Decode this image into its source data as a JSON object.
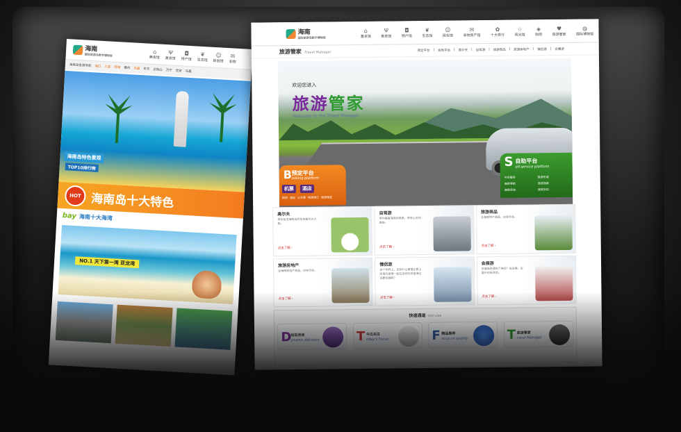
{
  "left_page": {
    "logo": {
      "name": "海南",
      "sub": "国际旅游岛数字博物馆"
    },
    "nav": [
      "美食馆",
      "美食馆",
      "特产馆",
      "生态馆",
      "民俗馆",
      "非物"
    ],
    "bar": [
      "海南岛各景导航",
      "海口",
      "三亚",
      "琼海",
      "儋州",
      "文昌",
      "东方",
      "五指山",
      "万宁",
      "定安",
      "屯昌"
    ],
    "banner": {
      "title": "海南岛特色景观",
      "sub": "TOP10排行榜"
    },
    "hot": {
      "badge": "HOT",
      "text": "海南岛十大特色"
    },
    "bay": {
      "en": "bay",
      "cn": "海南十大海湾"
    },
    "sea": {
      "label": "NO.1  天下第一湾  亚龙湾"
    }
  },
  "right_page": {
    "logo": {
      "name": "海南",
      "sub": "国际旅游岛数字博物馆"
    },
    "nav": [
      {
        "icon": "house-icon",
        "label": "基本馆"
      },
      {
        "icon": "fork-icon",
        "label": "美食馆"
      },
      {
        "icon": "bag-icon",
        "label": "特产馆"
      },
      {
        "icon": "leaf-icon",
        "label": "生态馆"
      },
      {
        "icon": "mask-icon",
        "label": "民俗馆"
      },
      {
        "icon": "speech-icon",
        "label": "非物质产馆"
      },
      {
        "icon": "flower-icon",
        "label": "十大排行"
      },
      {
        "icon": "star-icon",
        "label": "观光馆"
      },
      {
        "icon": "gift-icon",
        "label": "购吧"
      },
      {
        "icon": "heart-icon",
        "label": "旅游管家"
      },
      {
        "icon": "globe-icon",
        "label": "国际博物馆"
      }
    ],
    "brand": {
      "title": "旅游管家",
      "en": "Travel Manager"
    },
    "links": [
      "预定平台",
      "自助平台",
      "高尔夫",
      "自驾游",
      "旅游商品",
      "旅游房地产",
      "情侣游",
      "会展游"
    ],
    "hero": {
      "welcome": "欢迎您进入",
      "title_a": "旅游",
      "title_b": "管家",
      "sub": "Welcome to the Travel Manager",
      "booking": {
        "letter": "B",
        "title": "预定平台",
        "en": "ooking platform",
        "btn1": "机票",
        "btn2": "酒店",
        "small": [
          "航班",
          "酒店",
          "火车票",
          "旅游预订",
          "旅游预定"
        ]
      },
      "self": {
        "letter": "S",
        "title": "自助平台",
        "en": "elf-service platform",
        "small": [
          "叫车服务",
          "旅游形成",
          "自助导航",
          "旅游指南",
          "自助咨询",
          "商家折扣"
        ]
      }
    },
    "cells": [
      {
        "title": "高尔夫",
        "desc": "带你走进海南岛的生态高尔夫之旅。",
        "more": "点击了解 ›"
      },
      {
        "title": "自驾游",
        "desc": "带你看看海南的美景，享受心灵的自由。",
        "more": "点击了解 ›"
      },
      {
        "title": "旅游商品",
        "desc": "全海南特产商品，应有尽有。",
        "more": "点击了解 ›"
      },
      {
        "title": "旅游房地产",
        "desc": "全海南房地产商品，应有尽有。",
        "more": "点击了解 ›"
      },
      {
        "title": "情侣游",
        "desc": "这个世界上，还有什么事情比跟上所爱的爱情一起在这样的天堂海边还要幸福呢？",
        "more": "点击了解 ›"
      },
      {
        "title": "会展游",
        "desc": "会展商务遇到了麻烦？在这里，会展中的新体验。",
        "more": "点击了解 ›"
      }
    ],
    "fast": {
      "title": "快速通道",
      "en": "FAST-LINK",
      "items": [
        {
          "letter": "D",
          "cn": "动态咨询",
          "en": "ynamic Advisory",
          "color": "#7a2a9c"
        },
        {
          "letter": "T",
          "cn": "今日关注",
          "en": "oday's Focus",
          "color": "#c33"
        },
        {
          "letter": "F",
          "cn": "精品推荐",
          "en": "ocus on quality",
          "color": "#2a5aa6"
        },
        {
          "letter": "T",
          "cn": "旅游管家",
          "en": "ravel Manager",
          "color": "#2f9a2f"
        }
      ]
    }
  }
}
